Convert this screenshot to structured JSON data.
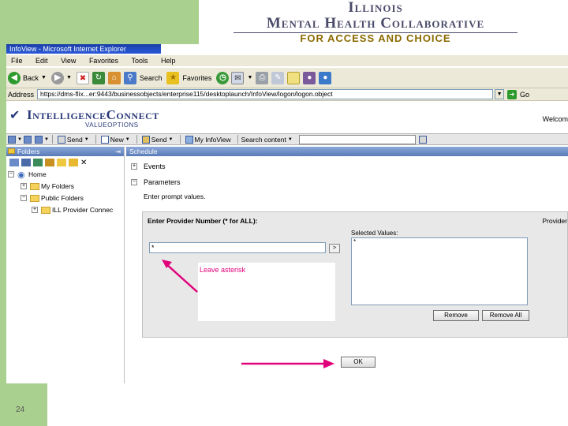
{
  "slide": {
    "number": "24"
  },
  "logo": {
    "line1": "Illinois",
    "line2": "Mental Health Collaborative",
    "line3": "FOR ACCESS AND CHOICE"
  },
  "browser": {
    "title": "InfoView - Microsoft Internet Explorer",
    "menu": [
      "File",
      "Edit",
      "View",
      "Favorites",
      "Tools",
      "Help"
    ],
    "toolbar": {
      "back": "Back",
      "search": "Search",
      "favorites": "Favorites"
    },
    "address": {
      "label": "Address",
      "url": "https://dms-flix...er:9443/businessobjects/enterprise115/desktoplaunch/InfoView/logon/logon.object",
      "go": "Go"
    }
  },
  "app": {
    "brand": "IntelligenceConnect",
    "brand_sub": "VALUEOPTIONS",
    "welcome": "Welcom",
    "toolbar": {
      "send": "Send",
      "new": "New",
      "my_infoview": "My InfoView",
      "search_content": "Search content"
    }
  },
  "folders": {
    "title": "Folders",
    "tree": [
      {
        "label": "Home"
      },
      {
        "label": "My Folders"
      },
      {
        "label": "Public Folders"
      },
      {
        "label": "ILL Provider Connec"
      }
    ]
  },
  "schedule": {
    "title": "Schedule",
    "events": "Events",
    "parameters": "Parameters",
    "enter_prompt": "Enter prompt values.",
    "prompt_title": "Enter Provider Number (* for ALL):",
    "provider_cut": "Provider",
    "input_value": "*",
    "hint": "Leave asterisk",
    "selected_label": "Selected Values:",
    "selected_item": "*",
    "remove": "Remove",
    "remove_all": "Remove All",
    "ok": "OK"
  }
}
